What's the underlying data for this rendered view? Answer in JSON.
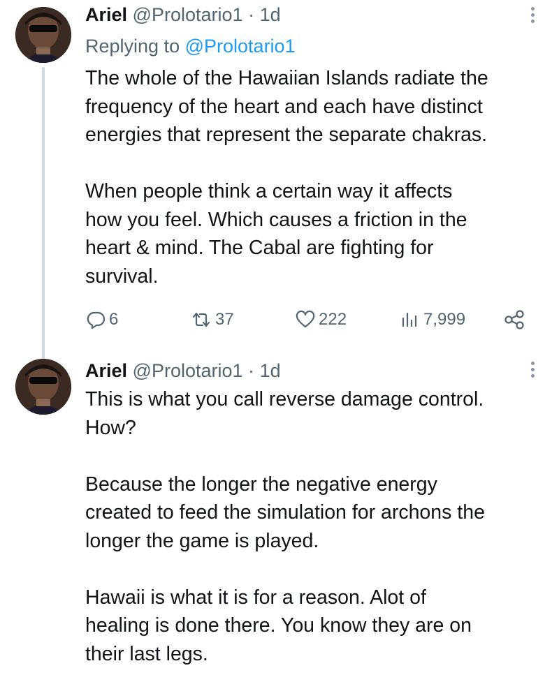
{
  "thread": {
    "tweets": [
      {
        "author_name": "Ariel",
        "author_handle": "@Prolotario1",
        "separator": "·",
        "timestamp": "1d",
        "replying_prefix": "Replying to",
        "replying_to": "@Prolotario1",
        "paragraphs": [
          "The whole of the Hawaiian Islands radiate the\nfrequency of the heart and each have distinct\nenergies that represent the separate chakras.",
          "When people think a certain way it affects\nhow you feel. Which causes a friction in the\nheart & mind. The Cabal are fighting for\nsurvival."
        ],
        "actions": {
          "replies": "6",
          "retweets": "37",
          "likes": "222",
          "views": "7,999"
        }
      },
      {
        "author_name": "Ariel",
        "author_handle": "@Prolotario1",
        "separator": "·",
        "timestamp": "1d",
        "paragraphs": [
          "This is what you call reverse damage control.\nHow?",
          "Because the longer the negative energy\ncreated to feed the simulation for archons the\nlonger the game is played.",
          "Hawaii is what it is for a reason. Alot of\nhealing is done there. You know they are on\ntheir last legs."
        ]
      }
    ]
  },
  "colors": {
    "text_primary": "#0f1419",
    "text_secondary": "#536471",
    "mention": "#1d9bf0",
    "thread_line": "#cfd9de",
    "more_dots": "#8b98a5"
  },
  "icons": {
    "reply": "reply-icon",
    "retweet": "retweet-icon",
    "like": "heart-icon",
    "views": "views-chart-icon",
    "share": "share-icon",
    "more": "more-vertical-icon"
  }
}
